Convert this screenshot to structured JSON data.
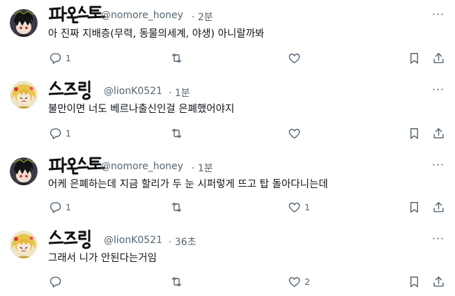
{
  "replies": [
    {
      "display_name": "파오스트",
      "handle": "@nomore_honey",
      "time": "· 2분",
      "text": "아 진짜 지배층(무력, 동물의세계, 야생) 아니랄까봐",
      "reply_count": "1",
      "retweet_count": "",
      "like_count": "",
      "avatar": "dark-haired-character"
    },
    {
      "display_name": "스즈링",
      "handle": "@lionK0521",
      "time": "· 1분",
      "text": "불만이면 너도 베르나출신인걸 은폐했어야지",
      "reply_count": "1",
      "retweet_count": "",
      "like_count": "",
      "avatar": "blonde-character"
    },
    {
      "display_name": "파오스트",
      "handle": "@nomore_honey",
      "time": "· 1분",
      "text": "어케 은폐하는데 지금 할리가 두 눈 시퍼렇게 뜨고 탑 돌아다니는데",
      "reply_count": "1",
      "retweet_count": "",
      "like_count": "1",
      "avatar": "dark-haired-character"
    },
    {
      "display_name": "스즈링",
      "handle": "@lionK0521",
      "time": "· 36초",
      "text": "그래서 니가 안된다는거임",
      "reply_count": "",
      "retweet_count": "",
      "like_count": "2",
      "avatar": "blonde-character"
    }
  ],
  "icons": {
    "reply": "reply-icon",
    "retweet": "retweet-icon",
    "like": "like-icon",
    "bookmark": "bookmark-icon",
    "share": "share-icon",
    "more": "more-icon"
  },
  "colors": {
    "text": "#0f1419",
    "muted": "#536471",
    "background": "#ffffff"
  }
}
